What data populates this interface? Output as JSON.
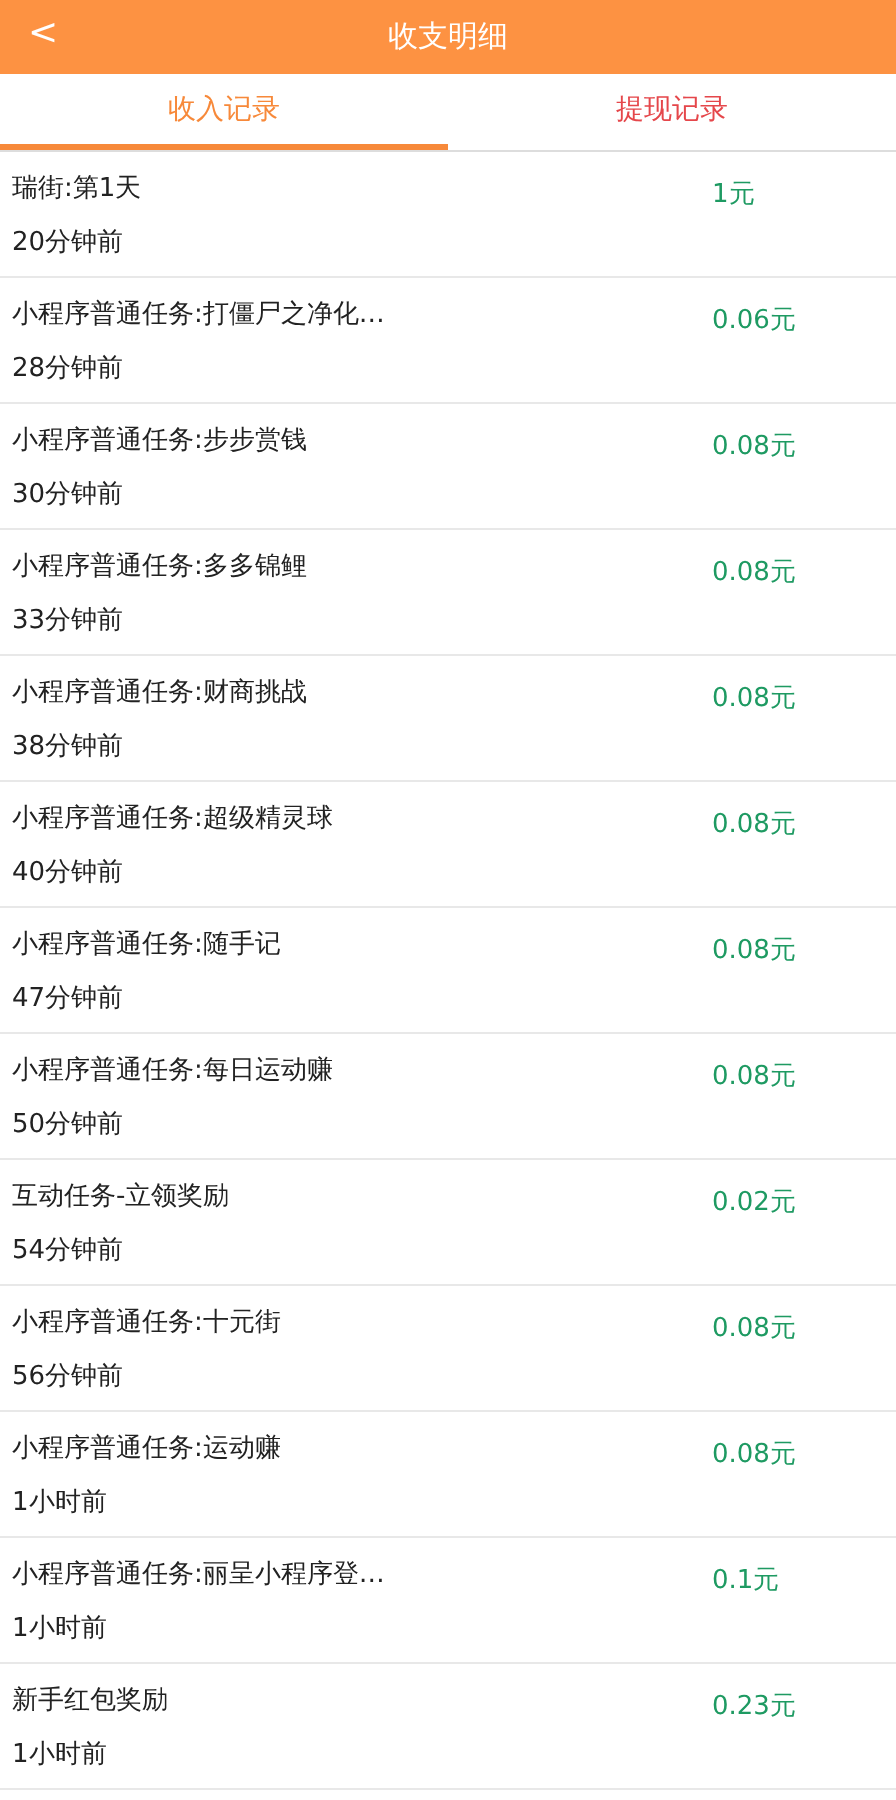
{
  "header": {
    "back": "<",
    "title": "收支明细"
  },
  "tabs": [
    {
      "label": "收入记录",
      "selected": true
    },
    {
      "label": "提现记录",
      "selected": false
    }
  ],
  "records": [
    {
      "title": "瑞街:第1天",
      "time": "20分钟前",
      "amount": "1元"
    },
    {
      "title": "小程序普通任务:打僵尸之净化…",
      "time": "28分钟前",
      "amount": "0.06元"
    },
    {
      "title": "小程序普通任务:步步赏钱",
      "time": "30分钟前",
      "amount": "0.08元"
    },
    {
      "title": "小程序普通任务:多多锦鲤",
      "time": "33分钟前",
      "amount": "0.08元"
    },
    {
      "title": "小程序普通任务:财商挑战",
      "time": "38分钟前",
      "amount": "0.08元"
    },
    {
      "title": "小程序普通任务:超级精灵球",
      "time": "40分钟前",
      "amount": "0.08元"
    },
    {
      "title": "小程序普通任务:随手记",
      "time": "47分钟前",
      "amount": "0.08元"
    },
    {
      "title": "小程序普通任务:每日运动赚",
      "time": "50分钟前",
      "amount": "0.08元"
    },
    {
      "title": "互动任务-立领奖励",
      "time": "54分钟前",
      "amount": "0.02元"
    },
    {
      "title": "小程序普通任务:十元街",
      "time": "56分钟前",
      "amount": "0.08元"
    },
    {
      "title": "小程序普通任务:运动赚",
      "time": "1小时前",
      "amount": "0.08元"
    },
    {
      "title": "小程序普通任务:丽呈小程序登…",
      "time": "1小时前",
      "amount": "0.1元"
    },
    {
      "title": "新手红包奖励",
      "time": "1小时前",
      "amount": "0.23元"
    }
  ]
}
